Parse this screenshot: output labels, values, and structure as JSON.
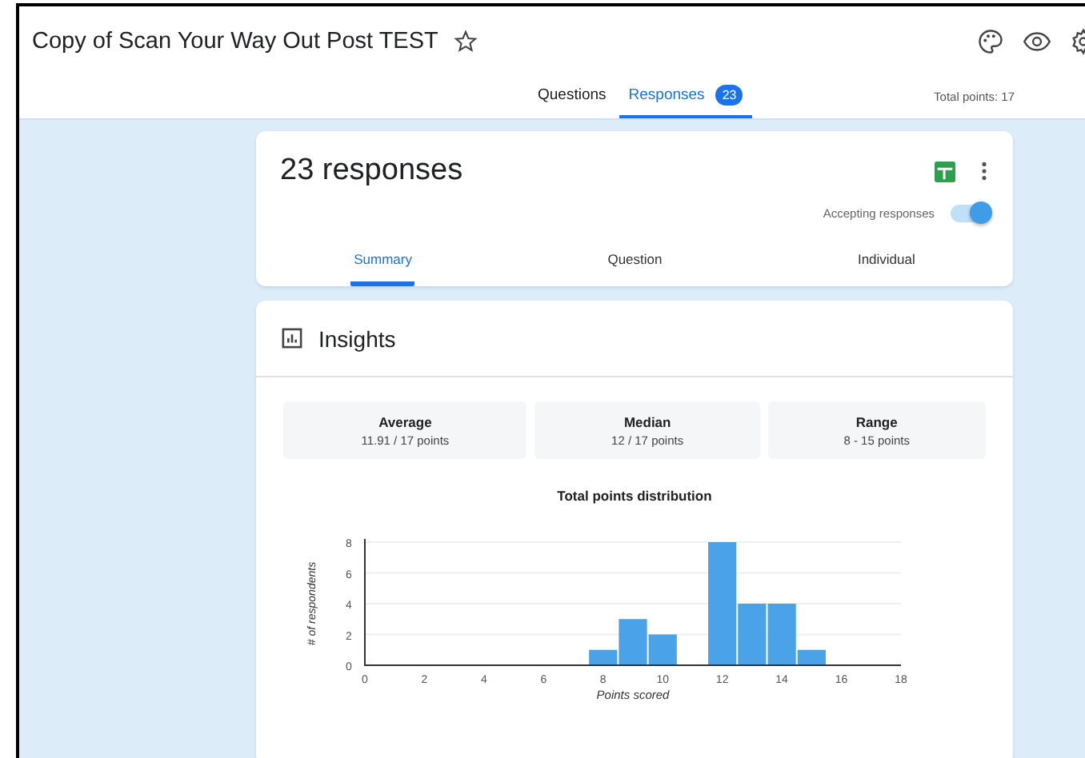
{
  "header": {
    "title": "Copy of Scan Your Way Out Post TEST",
    "starred": false,
    "tabs": [
      {
        "label": "Questions",
        "selected": false
      },
      {
        "label": "Responses",
        "selected": true,
        "badge": "23"
      }
    ],
    "total_points": "Total points: 17"
  },
  "responses_card": {
    "heading": "23 responses",
    "accepting": {
      "label": "Accepting responses",
      "on": true
    },
    "tabs": [
      {
        "label": "Summary",
        "selected": true
      },
      {
        "label": "Question",
        "selected": false
      },
      {
        "label": "Individual",
        "selected": false
      }
    ]
  },
  "insights": {
    "title": "Insights",
    "stats": [
      {
        "label": "Average",
        "value": "11.91 / 17 points"
      },
      {
        "label": "Median",
        "value": "12 / 17 points"
      },
      {
        "label": "Range",
        "value": "8 - 15 points"
      }
    ],
    "chart_data": {
      "type": "bar",
      "title": "Total points distribution",
      "xlabel": "Points scored",
      "ylabel": "# of respondents",
      "x": [
        8,
        9,
        10,
        12,
        13,
        14,
        15
      ],
      "values": [
        1,
        3,
        2,
        8,
        4,
        4,
        1
      ],
      "grid": true,
      "xlim": [
        0,
        18
      ],
      "ylim": [
        0,
        8
      ],
      "xticks": [
        0,
        2,
        4,
        6,
        8,
        10,
        12,
        14,
        16,
        18
      ],
      "yticks": [
        0,
        2,
        4,
        6,
        8
      ]
    }
  }
}
